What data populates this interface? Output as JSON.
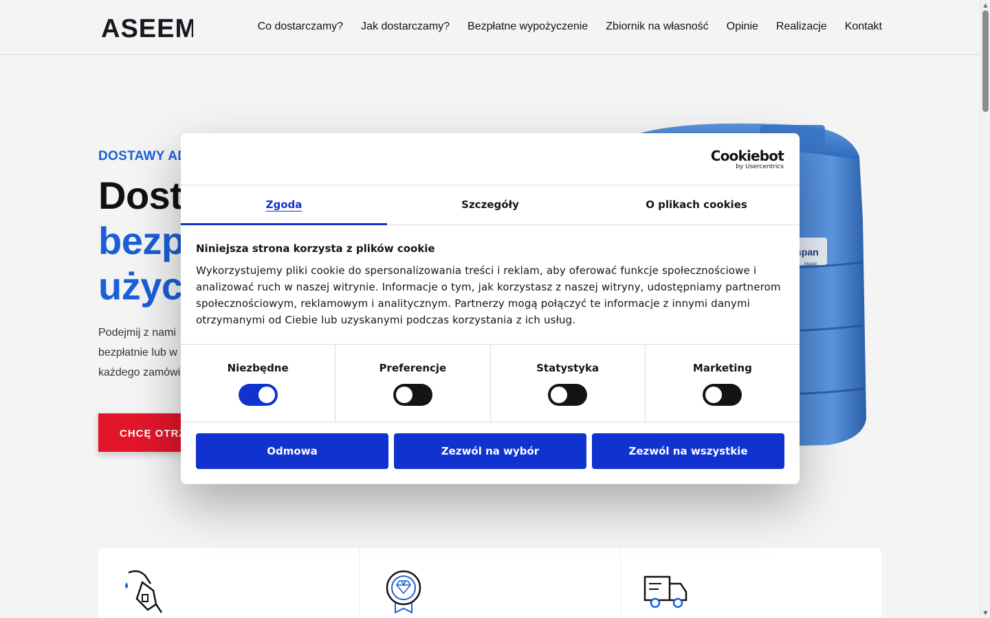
{
  "header": {
    "logo_text": "ASEEM",
    "nav": [
      {
        "label": "Co dostarczamy?"
      },
      {
        "label": "Jak dostarczamy?"
      },
      {
        "label": "Bezpłatne wypożyczenie"
      },
      {
        "label": "Zbiornik na własność"
      },
      {
        "label": "Opinie"
      },
      {
        "label": "Realizacje"
      },
      {
        "label": "Kontakt"
      }
    ]
  },
  "hero": {
    "eyebrow": "DOSTAWY ADI",
    "title_line1": "Dosto",
    "title_line2": "bezpł",
    "title_line3": "użycz",
    "desc_line1": "Podejmij z nami",
    "desc_line2": "bezpłatnie lub w",
    "desc_line3": "każdego zamówie",
    "cta_label": "CHCĘ OTRZY",
    "tank_brand": "span",
    "tank_sub": "Master"
  },
  "features": [
    {
      "icon": "fuel-nozzle-icon"
    },
    {
      "icon": "quality-diamond-badge-icon"
    },
    {
      "icon": "delivery-truck-icon"
    }
  ],
  "cookie": {
    "brand": "Cookiebot",
    "brand_sub": "by Usercentrics",
    "tabs": [
      {
        "label": "Zgoda",
        "active": true
      },
      {
        "label": "Szczegóły",
        "active": false
      },
      {
        "label": "O plikach cookies",
        "active": false
      }
    ],
    "heading": "Niniejsza strona korzysta z plików cookie",
    "text": "Wykorzystujemy pliki cookie do spersonalizowania treści i reklam, aby oferować funkcje społecznościowe i analizować ruch w naszej witrynie. Informacje o tym, jak korzystasz z naszej witryny, udostępniamy partnerom społecznościowym, reklamowym i analitycznym. Partnerzy mogą połączyć te informacje z innymi danymi otrzymanymi od Ciebie lub uzyskanymi podczas korzystania z ich usług.",
    "toggles": [
      {
        "label": "Niezbędne",
        "on": true
      },
      {
        "label": "Preferencje",
        "on": false
      },
      {
        "label": "Statystyka",
        "on": false
      },
      {
        "label": "Marketing",
        "on": false
      }
    ],
    "buttons": {
      "deny": "Odmowa",
      "allow_selection": "Zezwól na wybór",
      "allow_all": "Zezwól na wszystkie"
    }
  },
  "colors": {
    "brand_blue": "#1a5fd8",
    "cta_red": "#e3152b",
    "cookiebot_blue": "#1032cf"
  }
}
